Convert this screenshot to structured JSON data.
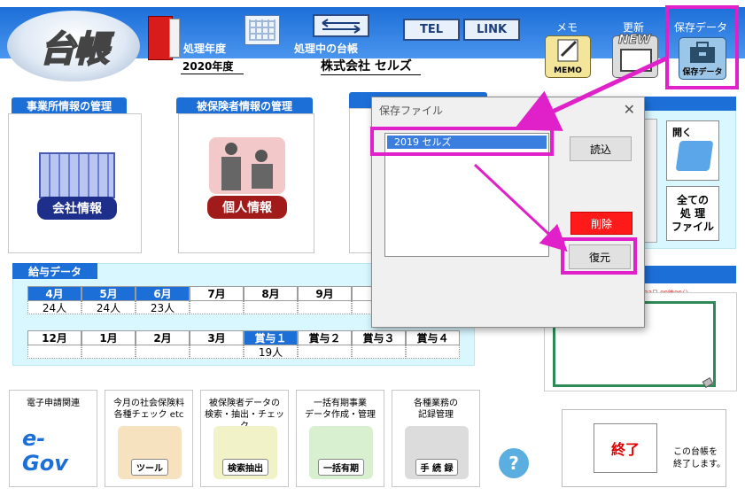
{
  "header": {
    "logo": "台帳",
    "year_label": "処理年度",
    "ledger_label": "処理中の台帳",
    "year_value": "2020年度",
    "company_value": "株式会社 セルズ",
    "tel": "TEL",
    "link": "LINK",
    "memo": {
      "caption": "メモ",
      "label": "MEMO"
    },
    "update": {
      "caption": "更新",
      "badge": "NEW"
    },
    "saved": {
      "caption": "保存データ",
      "label": "保存データ"
    }
  },
  "panels": {
    "office": {
      "title": "事業所情報の管理",
      "button": "会社情報"
    },
    "insured": {
      "title": "被保険者情報の管理",
      "button": "個人情報"
    }
  },
  "right_panel": {
    "open_label": "開く",
    "all_files_label": "全ての\n処 理\nファイル"
  },
  "clock_text": "月23日 09時00分",
  "salary": {
    "title": "給与データ",
    "row1": [
      {
        "month": "4月",
        "count": "24人",
        "active": true
      },
      {
        "month": "5月",
        "count": "24人",
        "active": true
      },
      {
        "month": "6月",
        "count": "23人",
        "active": true
      },
      {
        "month": "7月",
        "count": "",
        "active": false
      },
      {
        "month": "8月",
        "count": "",
        "active": false
      },
      {
        "month": "9月",
        "count": "",
        "active": false
      },
      {
        "month": "1",
        "count": "",
        "active": false
      }
    ],
    "row2": [
      {
        "month": "12月",
        "count": "",
        "active": false
      },
      {
        "month": "1月",
        "count": "",
        "active": false
      },
      {
        "month": "2月",
        "count": "",
        "active": false
      },
      {
        "month": "3月",
        "count": "",
        "active": false
      },
      {
        "month": "賞与１",
        "count": "19人",
        "active": true
      },
      {
        "month": "賞与２",
        "count": "",
        "active": false
      },
      {
        "month": "賞与３",
        "count": "",
        "active": false
      },
      {
        "month": "賞与４",
        "count": "",
        "active": false
      }
    ]
  },
  "tools": [
    {
      "top": "電子申請関連",
      "label": "e-Gov",
      "sub": "[イーガブ]"
    },
    {
      "top": "今月の社会保険料\n各種チェック etc",
      "label": "ツール"
    },
    {
      "top": "被保険者データの\n検索・抽出・チェック",
      "label": "検索抽出"
    },
    {
      "top": "一括有期事業\nデータ作成・管理",
      "label": "一括有期"
    },
    {
      "top": "各種業務の\n記録管理",
      "label": "手 続 録"
    }
  ],
  "help": "?",
  "exit": {
    "button": "終了",
    "note": "この台帳を\n終了します。"
  },
  "dialog": {
    "title": "保存ファイル",
    "close": "✕",
    "items": [
      "2019 セルズ"
    ],
    "load": "読込",
    "delete": "削除",
    "restore": "復元"
  },
  "colors": {
    "accent": "#1d6fd8",
    "highlight": "#e020c8",
    "delete": "#ff1a1a"
  }
}
